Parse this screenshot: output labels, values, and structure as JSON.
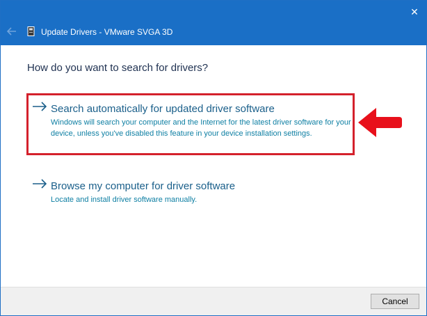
{
  "window": {
    "title": "Update Drivers - VMware SVGA 3D",
    "close_glyph": "✕",
    "accent": "#1a6fc6"
  },
  "main": {
    "question": "How do you want to search for drivers?",
    "options": [
      {
        "title": "Search automatically for updated driver software",
        "description": "Windows will search your computer and the Internet for the latest driver software for your device, unless you've disabled this feature in your device installation settings.",
        "icon": "arrow-right-icon"
      },
      {
        "title": "Browse my computer for driver software",
        "description": "Locate and install driver software manually.",
        "icon": "arrow-right-icon"
      }
    ]
  },
  "annotation": {
    "highlight_color": "#d4212c",
    "pointer_icon": "red-arrow-left-icon"
  },
  "footer": {
    "cancel_label": "Cancel"
  }
}
